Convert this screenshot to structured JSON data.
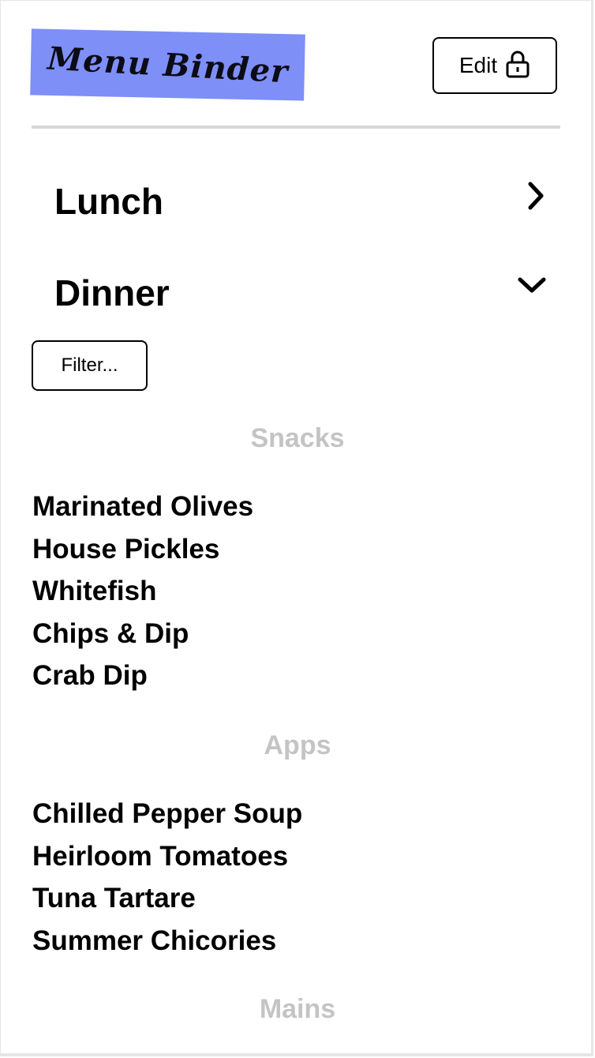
{
  "app": {
    "logo_text": "Menu Binder",
    "logo_color": "#7e8ff8"
  },
  "header": {
    "edit_label": "Edit",
    "edit_icon": "lock-icon"
  },
  "sections": [
    {
      "label": "Lunch",
      "state": "collapsed",
      "icon": "chevron-right-icon"
    },
    {
      "label": "Dinner",
      "state": "expanded",
      "icon": "chevron-down-icon"
    }
  ],
  "filter": {
    "label": "Filter..."
  },
  "dinner": {
    "categories": [
      {
        "name": "Snacks",
        "items": [
          "Marinated Olives",
          "House Pickles",
          "Whitefish",
          "Chips & Dip",
          "Crab Dip"
        ]
      },
      {
        "name": "Apps",
        "items": [
          "Chilled Pepper Soup",
          "Heirloom Tomatoes",
          "Tuna Tartare",
          "Summer Chicories"
        ]
      },
      {
        "name": "Mains",
        "items": []
      }
    ]
  }
}
